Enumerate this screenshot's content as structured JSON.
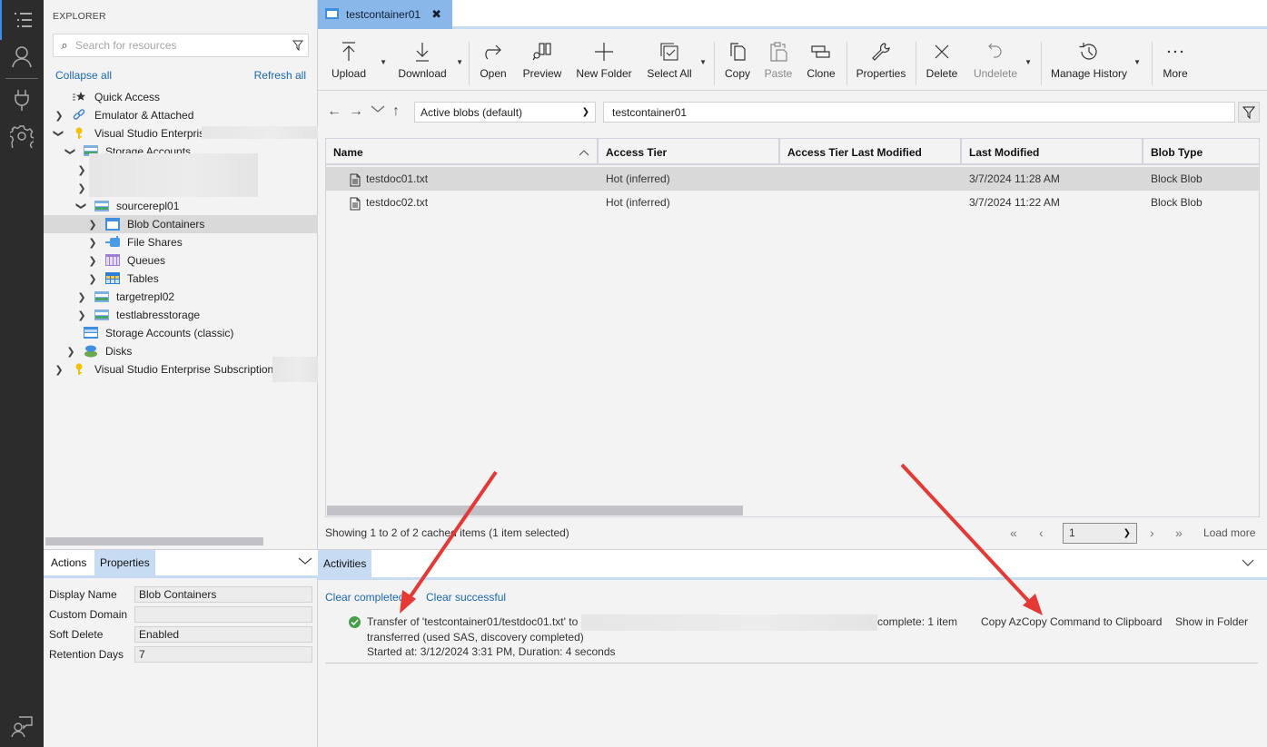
{
  "activity_bar": {
    "items": [
      {
        "icon": "explorer-icon",
        "active": true
      },
      {
        "icon": "account-icon",
        "active": false
      },
      {
        "icon": "plug-icon",
        "active": false
      },
      {
        "icon": "settings-icon",
        "active": false
      }
    ],
    "bottom_icon": "feedback-icon"
  },
  "sidebar": {
    "title": "EXPLORER",
    "search_placeholder": "Search for resources",
    "collapse_all": "Collapse all",
    "refresh_all": "Refresh all",
    "tree": [
      {
        "label": "Quick Access",
        "icon": "quick-access-icon",
        "expander": "none",
        "indent": 0
      },
      {
        "label": "Emulator & Attached",
        "icon": "link-icon",
        "expander": "collapsed",
        "indent": 0
      },
      {
        "label": "Visual Studio Enterpris",
        "icon": "key-icon",
        "expander": "expanded",
        "indent": 0,
        "redacted": true
      },
      {
        "label": "Storage Accounts",
        "icon": "storage-account-icon",
        "expander": "expanded",
        "indent": 1
      },
      {
        "label": "",
        "icon": "",
        "expander": "collapsed",
        "indent": 2,
        "redacted": true
      },
      {
        "label": "",
        "icon": "",
        "expander": "collapsed",
        "indent": 2,
        "redacted": true
      },
      {
        "label": "sourcerepl01",
        "icon": "storage-account-icon",
        "expander": "expanded",
        "indent": 2
      },
      {
        "label": "Blob Containers",
        "icon": "blob-container-icon",
        "expander": "collapsed",
        "indent": 3,
        "selected": true
      },
      {
        "label": "File Shares",
        "icon": "file-share-icon",
        "expander": "collapsed",
        "indent": 3
      },
      {
        "label": "Queues",
        "icon": "queue-icon",
        "expander": "collapsed",
        "indent": 3
      },
      {
        "label": "Tables",
        "icon": "table-icon",
        "expander": "collapsed",
        "indent": 3
      },
      {
        "label": "targetrepl02",
        "icon": "storage-account-icon",
        "expander": "collapsed",
        "indent": 2
      },
      {
        "label": "testlabresstorage",
        "icon": "storage-account-icon",
        "expander": "collapsed",
        "indent": 2
      },
      {
        "label": "Storage Accounts (classic)",
        "icon": "storage-classic-icon",
        "expander": "none",
        "indent": 1
      },
      {
        "label": "Disks",
        "icon": "disk-icon",
        "expander": "collapsed",
        "indent": 1
      },
      {
        "label": "Visual Studio Enterprise Subscription",
        "icon": "key-icon",
        "expander": "collapsed",
        "indent": 0,
        "redacted": true
      }
    ]
  },
  "properties_panel": {
    "tabs": [
      "Actions",
      "Properties"
    ],
    "active_tab": "Properties",
    "rows": [
      {
        "label": "Display Name",
        "value": "Blob Containers"
      },
      {
        "label": "Custom Domain",
        "value": ""
      },
      {
        "label": "Soft Delete",
        "value": "Enabled"
      },
      {
        "label": "Retention Days",
        "value": "7"
      }
    ]
  },
  "editor": {
    "tab": {
      "label": "testcontainer01",
      "close": "✖"
    },
    "toolbar": [
      {
        "label": "Upload",
        "icon": "upload-icon",
        "dropdown": true,
        "disabled": false
      },
      {
        "label": "Download",
        "icon": "download-icon",
        "dropdown": true,
        "disabled": false
      },
      {
        "label": "Open",
        "icon": "open-icon",
        "dropdown": false,
        "disabled": false
      },
      {
        "label": "Preview",
        "icon": "preview-icon",
        "dropdown": false,
        "disabled": false
      },
      {
        "label": "New Folder",
        "icon": "plus-icon",
        "dropdown": false,
        "disabled": false
      },
      {
        "label": "Select All",
        "icon": "select-all-icon",
        "dropdown": true,
        "disabled": false
      },
      {
        "label": "Copy",
        "icon": "copy-icon",
        "dropdown": false,
        "disabled": false
      },
      {
        "label": "Paste",
        "icon": "paste-icon",
        "dropdown": false,
        "disabled": true
      },
      {
        "label": "Clone",
        "icon": "clone-icon",
        "dropdown": false,
        "disabled": false
      },
      {
        "label": "Properties",
        "icon": "wrench-icon",
        "dropdown": false,
        "disabled": false
      },
      {
        "label": "Delete",
        "icon": "delete-icon",
        "dropdown": false,
        "disabled": false
      },
      {
        "label": "Undelete",
        "icon": "undo-icon",
        "dropdown": true,
        "disabled": true
      },
      {
        "label": "Manage History",
        "icon": "history-icon",
        "dropdown": true,
        "disabled": false
      },
      {
        "label": "More",
        "icon": "more-icon",
        "dropdown": false,
        "disabled": false
      }
    ],
    "view_select": "Active blobs (default)",
    "path": "testcontainer01",
    "grid": {
      "columns": [
        "Name",
        "Access Tier",
        "Access Tier Last Modified",
        "Last Modified",
        "Blob Type"
      ],
      "sort_column": "Name",
      "rows": [
        {
          "name": "testdoc01.txt",
          "access_tier": "Hot (inferred)",
          "tier_modified": "",
          "last_modified": "3/7/2024 11:28 AM",
          "blob_type": "Block Blob",
          "selected": true
        },
        {
          "name": "testdoc02.txt",
          "access_tier": "Hot (inferred)",
          "tier_modified": "",
          "last_modified": "3/7/2024 11:22 AM",
          "blob_type": "Block Blob",
          "selected": false
        }
      ]
    },
    "status": "Showing 1 to 2 of 2 cached items (1 item selected)",
    "pager": {
      "page": "1",
      "load_more": "Load more"
    }
  },
  "activities": {
    "tab": "Activities",
    "clear_completed": "Clear completed",
    "clear_successful": "Clear successful",
    "items": [
      {
        "status": "success",
        "line1_prefix": "Transfer of 'testcontainer01/testdoc01.txt' to",
        "line1_suffix": "complete: 1 item",
        "line2": "transferred (used SAS, discovery completed)",
        "line3": "Started at: 3/12/2024 3:31 PM, Duration: 4 seconds",
        "copy_azcopy": "Copy AzCopy Command to Clipboard",
        "show_in_folder": "Show in Folder"
      }
    ]
  },
  "colors": {
    "accent": "#8ab7ea",
    "link": "#1a67b5",
    "annotation_arrow": "#e53935"
  }
}
